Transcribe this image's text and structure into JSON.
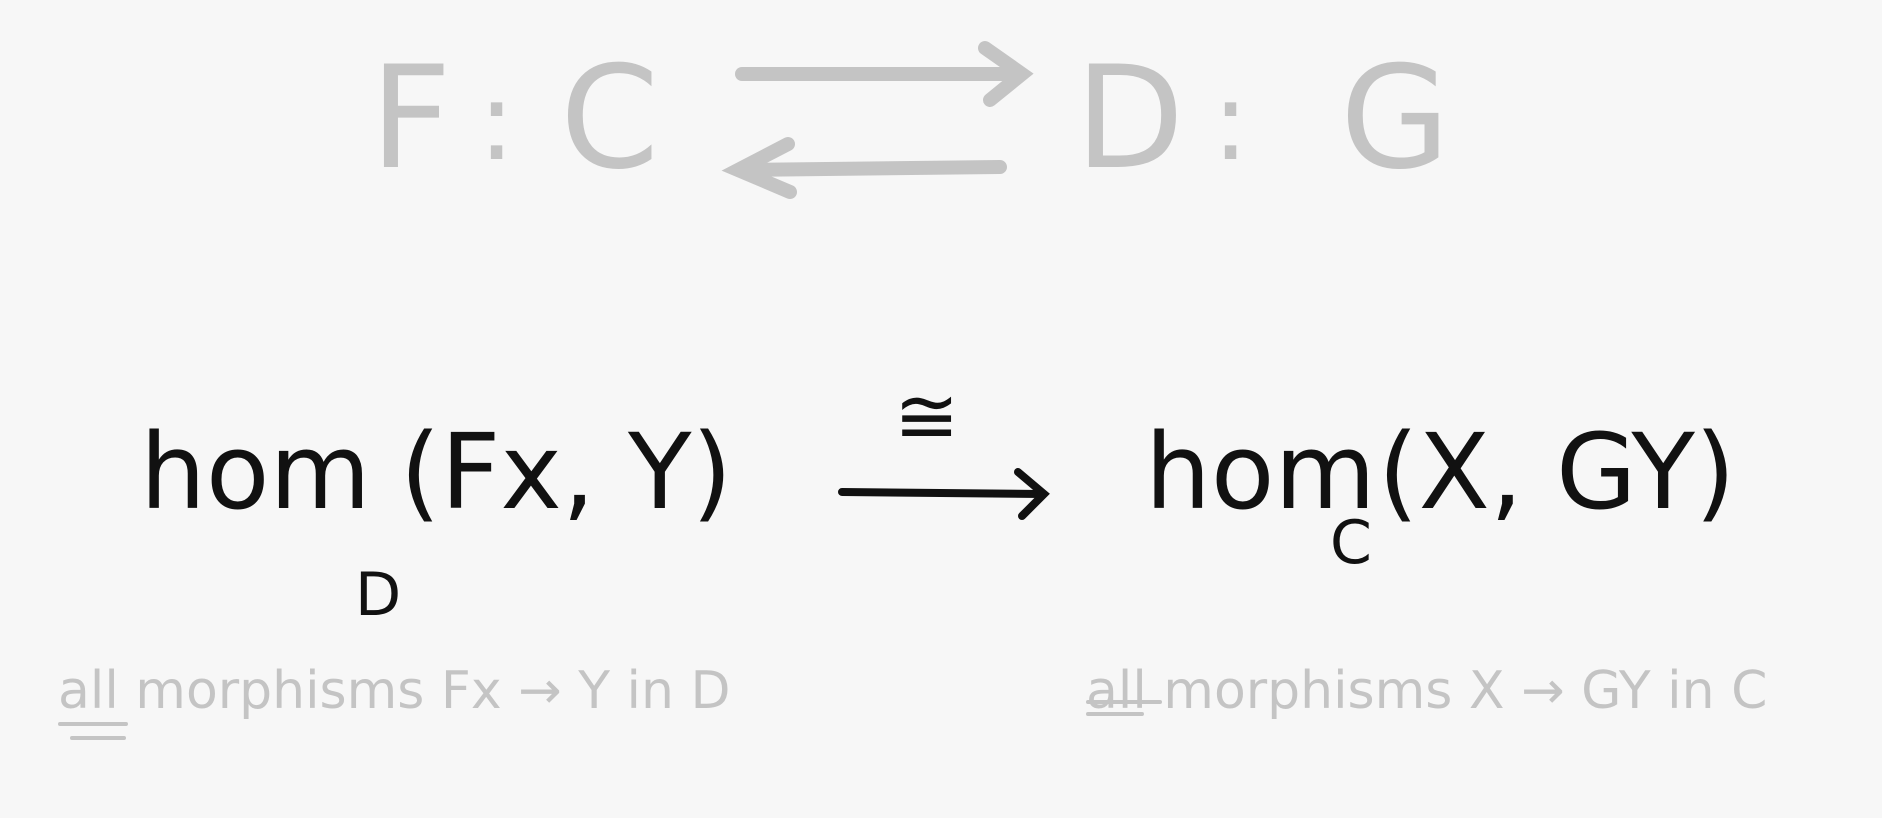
{
  "adjunction": {
    "left_functor": "F",
    "colon_left": ":",
    "source_category": "C",
    "target_category": "D",
    "colon_right": ":",
    "right_functor": "G"
  },
  "equation": {
    "lhs_hom": "hom",
    "lhs_subscript": "D",
    "lhs_args": "(Fx, Y)",
    "iso_symbol": "≅",
    "rhs_hom": "hom",
    "rhs_subscript": "C",
    "rhs_args": "(X, GY)"
  },
  "captions": {
    "left_all": "all",
    "left_rest": "morphisms Fx → Y in D",
    "right_all": "all",
    "right_rest": "morphisms X → GY in C"
  },
  "colors": {
    "ink": "#111111",
    "faded": "#c4c4c4",
    "paper": "#f7f7f7"
  }
}
